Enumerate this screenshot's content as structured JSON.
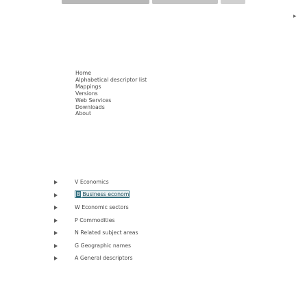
{
  "nav": {
    "items": [
      "Home",
      "Alphabetical descriptor list",
      "Mappings",
      "Versions",
      "Web Services",
      "Downloads",
      "About"
    ]
  },
  "corner_mark": "▸",
  "facets": [
    {
      "code": "V",
      "label": "Economics",
      "selected": false
    },
    {
      "code": "B",
      "label": "Business economics",
      "selected": true
    },
    {
      "code": "W",
      "label": "Economic sectors",
      "selected": false
    },
    {
      "code": "P",
      "label": "Commodities",
      "selected": false
    },
    {
      "code": "N",
      "label": "Related subject areas",
      "selected": false
    },
    {
      "code": "G",
      "label": "Geographic names",
      "selected": false
    },
    {
      "code": "A",
      "label": "General descriptors",
      "selected": false
    }
  ],
  "icons": {
    "expand": "chevron-right-icon"
  },
  "colors": {
    "selected_border": "#3c7a8a",
    "selected_code_bg": "#2f6d7e"
  }
}
